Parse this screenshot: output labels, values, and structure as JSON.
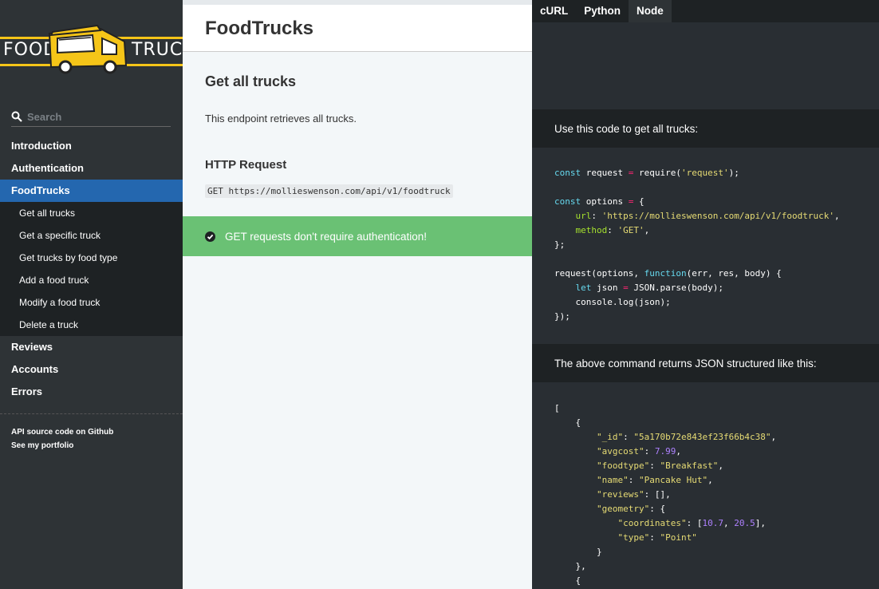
{
  "logo": {
    "left_word": "FOOD",
    "right_word": "TRUCK"
  },
  "search": {
    "placeholder": "Search"
  },
  "sidebar": {
    "items": [
      {
        "label": "Introduction"
      },
      {
        "label": "Authentication"
      },
      {
        "label": "FoodTrucks",
        "active": true,
        "children": [
          {
            "label": "Get all trucks"
          },
          {
            "label": "Get a specific truck"
          },
          {
            "label": "Get trucks by food type"
          },
          {
            "label": "Add a food truck"
          },
          {
            "label": "Modify a food truck"
          },
          {
            "label": "Delete a truck"
          }
        ]
      },
      {
        "label": "Reviews"
      },
      {
        "label": "Accounts"
      },
      {
        "label": "Errors"
      }
    ],
    "footer_links": [
      {
        "label": "API source code on Github"
      },
      {
        "label": "See my portfolio"
      }
    ]
  },
  "content": {
    "page_title": "FoodTrucks",
    "section_title": "Get all trucks",
    "description": "This endpoint retrieves all trucks.",
    "http_title": "HTTP Request",
    "http_request": "GET https://mollieswenson.com/api/v1/foodtruck",
    "notice": "GET requests don't require authentication!"
  },
  "code_panel": {
    "tabs": [
      {
        "label": "cURL"
      },
      {
        "label": "Python"
      },
      {
        "label": "Node",
        "active": true
      }
    ],
    "request_heading": "Use this code to get all trucks:",
    "response_heading": "The above command returns JSON structured like this:",
    "request_code": {
      "kw_const": "const",
      "kw_function": "function",
      "kw_let": "let",
      "var_request": "request",
      "var_options": "options",
      "fn_require": "require",
      "module": "'request'",
      "url_key": "url",
      "url_value": "'https://mollieswenson.com/api/v1/foodtruck'",
      "method_key": "method",
      "method_value": "'GET'",
      "call_args": "(err, res, body) {",
      "json_parse": "json",
      "json_parse_call": "JSON.parse(body);",
      "console_log": "console.log(json);"
    },
    "response": {
      "_id": "\"5a170b72e843ef23f66b4c38\"",
      "avgcost": "7.99",
      "foodtype": "\"Breakfast\"",
      "name": "\"Pancake Hut\"",
      "reviews": "[]",
      "coord_x": "10.7",
      "coord_y": "20.5",
      "type": "\"Point\""
    }
  },
  "colors": {
    "sidebar_bg": "#2e3336",
    "active_item": "#2467af",
    "notice_bg": "#6ac174",
    "code_bg": "#292e33",
    "logo_yellow": "#f5c518"
  }
}
